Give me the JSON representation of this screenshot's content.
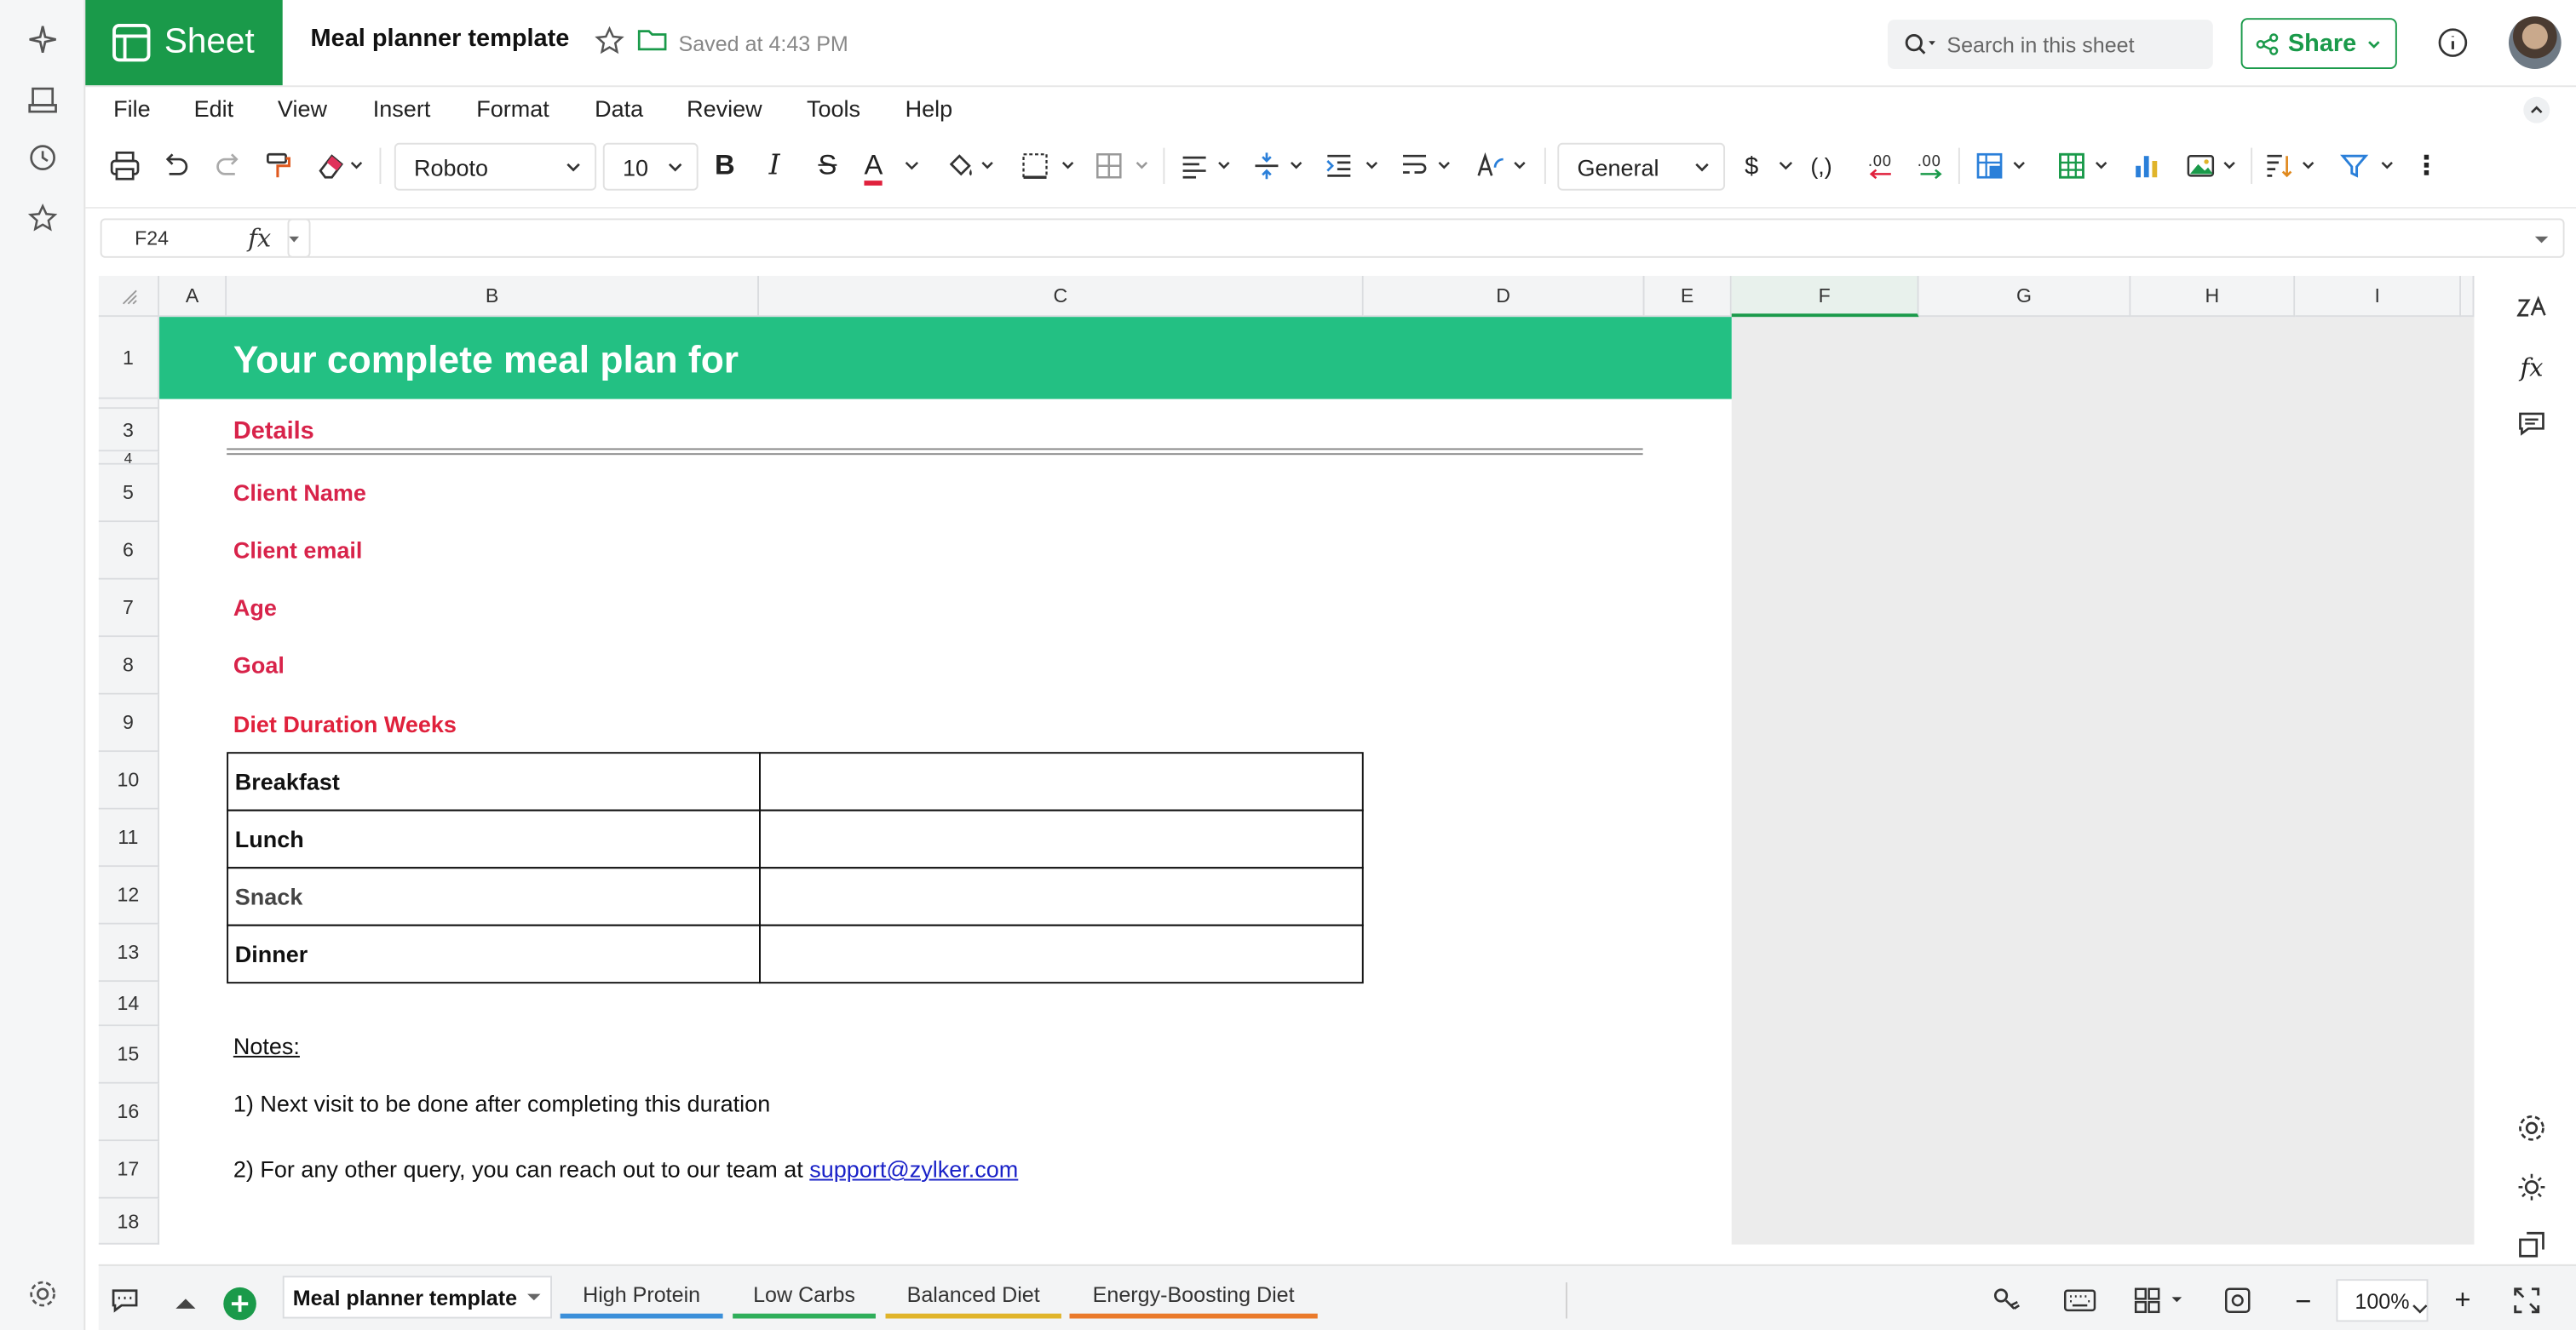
{
  "app": {
    "brand": "Sheet",
    "doc_title": "Meal planner template",
    "saved": "Saved at 4:43 PM"
  },
  "search": {
    "placeholder": "Search in this sheet"
  },
  "share": {
    "label": "Share"
  },
  "menu": [
    "File",
    "Edit",
    "View",
    "Insert",
    "Format",
    "Data",
    "Review",
    "Tools",
    "Help"
  ],
  "toolbar": {
    "font": "Roboto",
    "size": "10",
    "number_format": "General"
  },
  "formula": {
    "cell_ref": "F24",
    "fx": "fx",
    "value": ""
  },
  "columns": [
    "A",
    "B",
    "C",
    "D",
    "E",
    "F",
    "G",
    "H",
    "I"
  ],
  "selected_column": "F",
  "rows": [
    "1",
    "",
    "3",
    "4",
    "5",
    "6",
    "7",
    "8",
    "9",
    "10",
    "11",
    "12",
    "13",
    "14",
    "15",
    "16",
    "17",
    "18"
  ],
  "sheet": {
    "title": "Your complete meal plan for",
    "details": "Details",
    "client_name": "Client Name",
    "client_email": "Client email",
    "age": "Age",
    "goal": "Goal",
    "duration": "Diet Duration Weeks",
    "meals": [
      "Breakfast",
      "Lunch",
      "Snack",
      "Dinner"
    ],
    "notes_label": "Notes:",
    "note1": "1) Next visit to be done after completing this duration",
    "note2_prefix": "2) For any other query, you can reach out to our team at ",
    "note2_link": "support@zylker.com"
  },
  "tabs": [
    "Meal planner template",
    "High Protein",
    "Low Carbs",
    "Balanced Diet",
    "Energy-Boosting Diet"
  ],
  "tab_colors": [
    "#1a9a4a",
    "#3b8fd9",
    "#2fae5a",
    "#e0b42a",
    "#ea7a2b"
  ],
  "zoom": "100%",
  "colors": {
    "brand": "#1a9a4a",
    "band": "#23c083",
    "accent_red": "#d8234a",
    "link": "#1a22c8"
  }
}
